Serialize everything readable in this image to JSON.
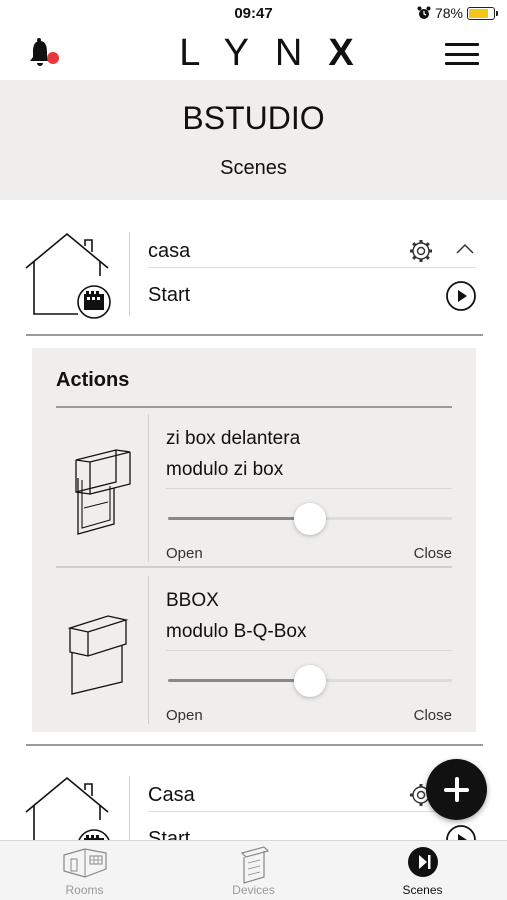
{
  "status_bar": {
    "time": "09:47",
    "battery": "78%",
    "battery_level": 0.78
  },
  "header": {
    "brand_letters": "LYN",
    "brand_x": "X"
  },
  "page": {
    "title": "BSTUDIO",
    "subtitle": "Scenes"
  },
  "scenes": [
    {
      "name": "casa",
      "start_label": "Start"
    },
    {
      "name": "Casa",
      "start_label": "Start"
    }
  ],
  "actions": {
    "title": "Actions",
    "items": [
      {
        "name": "zi box delantera",
        "model": "modulo zi box",
        "position": 0.5,
        "open_label": "Open",
        "close_label": "Close",
        "icon": "zip-screen-blind-icon"
      },
      {
        "name": "BBOX",
        "model": "modulo B-Q-Box",
        "position": 0.5,
        "open_label": "Open",
        "close_label": "Close",
        "icon": "box-blind-icon"
      }
    ]
  },
  "tabs": [
    {
      "label": "Rooms",
      "icon": "rooms-icon",
      "active": false
    },
    {
      "label": "Devices",
      "icon": "devices-icon",
      "active": false
    },
    {
      "label": "Scenes",
      "icon": "scenes-icon",
      "active": true
    }
  ],
  "colors": {
    "notification_dot": "#e8393a",
    "battery_fill": "#f5c518",
    "panel_bg": "#efeeec"
  }
}
